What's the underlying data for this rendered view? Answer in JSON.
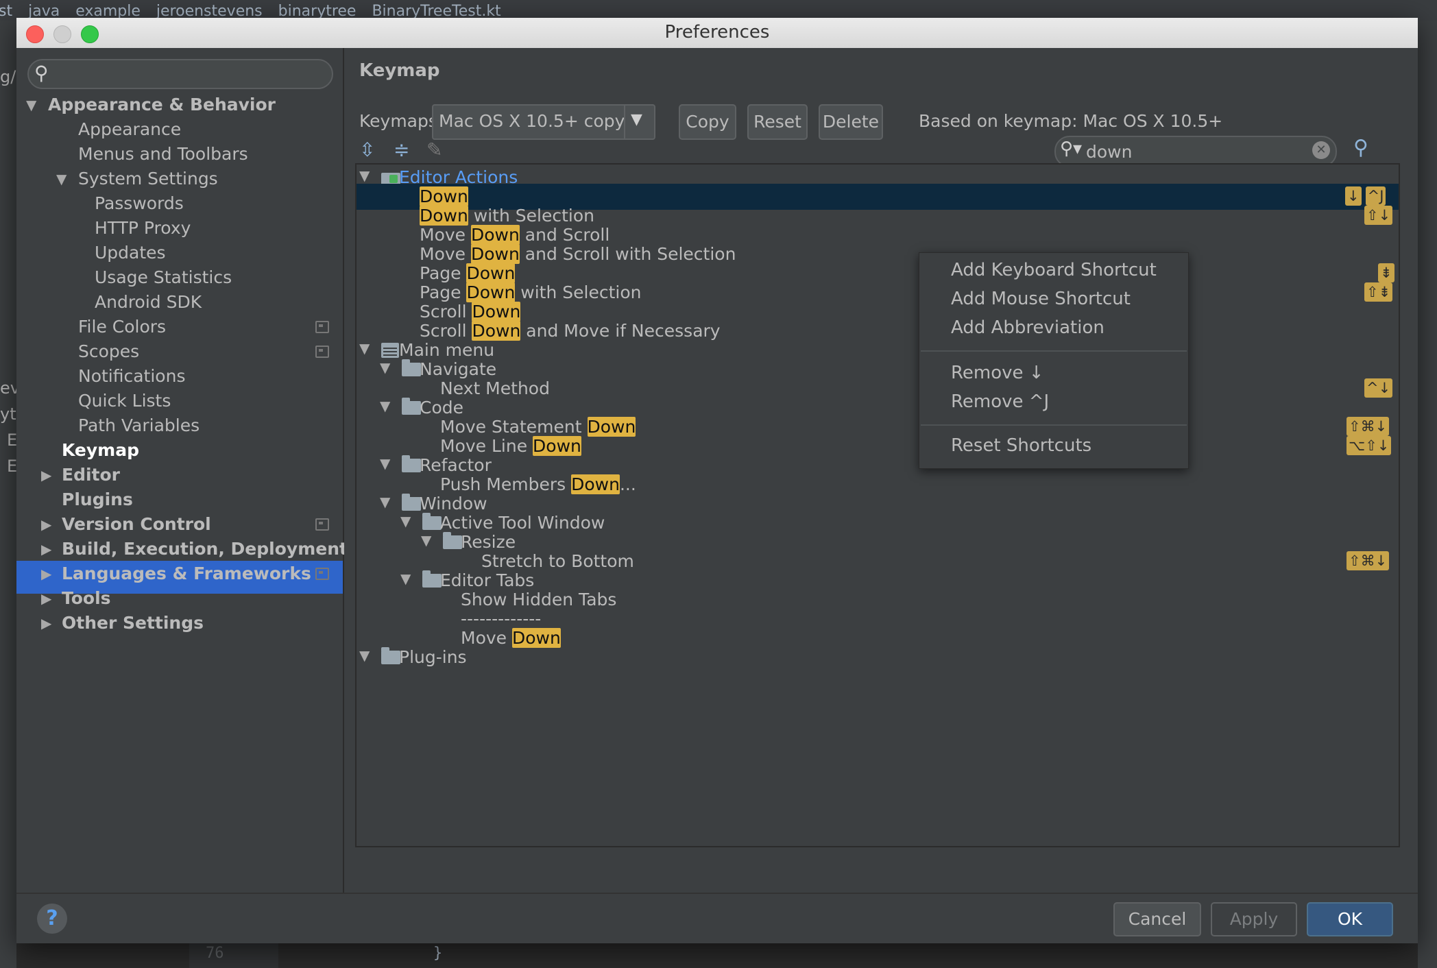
{
  "background": {
    "breadcrumbs": [
      "st",
      "java",
      "example",
      "jeroenstevens",
      "binarytree",
      "BinaryTreeTest.kt"
    ],
    "left_fragments": [
      "g/",
      "ev",
      "yt",
      "E",
      "E"
    ],
    "line_number": "76",
    "code_fragment": "}"
  },
  "window": {
    "title": "Preferences"
  },
  "sidebar": {
    "search_placeholder": "",
    "items": [
      {
        "label": "Appearance & Behavior"
      },
      {
        "label": "Appearance"
      },
      {
        "label": "Menus and Toolbars"
      },
      {
        "label": "System Settings"
      },
      {
        "label": "Passwords"
      },
      {
        "label": "HTTP Proxy"
      },
      {
        "label": "Updates"
      },
      {
        "label": "Usage Statistics"
      },
      {
        "label": "Android SDK"
      },
      {
        "label": "File Colors"
      },
      {
        "label": "Scopes"
      },
      {
        "label": "Notifications"
      },
      {
        "label": "Quick Lists"
      },
      {
        "label": "Path Variables"
      },
      {
        "label": "Keymap"
      },
      {
        "label": "Editor"
      },
      {
        "label": "Plugins"
      },
      {
        "label": "Version Control"
      },
      {
        "label": "Build, Execution, Deployment"
      },
      {
        "label": "Languages & Frameworks"
      },
      {
        "label": "Tools"
      },
      {
        "label": "Other Settings"
      }
    ]
  },
  "keymap": {
    "heading": "Keymap",
    "keymaps_label": "Keymaps:",
    "selected_keymap": "Mac OS X 10.5+ copy",
    "copy_label": "Copy",
    "reset_label": "Reset",
    "delete_label": "Delete",
    "based_on": "Based on keymap: Mac OS X 10.5+",
    "search_value": "down"
  },
  "tree": {
    "editor_actions": "Editor Actions",
    "down": "Down",
    "down_with_sel_rest": " with Selection",
    "move": "Move ",
    "and_scroll": " and Scroll",
    "and_scroll_sel": " and Scroll with Selection",
    "page": "Page ",
    "with_selection": " with Selection",
    "scroll": "Scroll ",
    "and_move_if": " and Move if Necessary",
    "main_menu": "Main menu",
    "navigate": "Navigate",
    "next_method": "Next Method",
    "code": "Code",
    "move_statement": "Move Statement ",
    "move_line": "Move Line ",
    "refactor": "Refactor",
    "push_members": "Push Members ",
    "ellipsis": "...",
    "window": "Window",
    "active_tool_window": "Active Tool Window",
    "resize": "Resize",
    "stretch_to_bottom": "Stretch to Bottom",
    "editor_tabs": "Editor Tabs",
    "show_hidden_tabs": "Show Hidden Tabs",
    "separator": "-------------",
    "plug_ins": "Plug-ins",
    "shortcuts": {
      "down": [
        "↓",
        "^J"
      ],
      "down_sel": [
        "⇧↓"
      ],
      "page_down": [
        "⇟"
      ],
      "page_down_sel": [
        "⇧⇟"
      ],
      "next_method": [
        "^↓"
      ],
      "move_statement": [
        "⇧⌘↓"
      ],
      "move_line": [
        "⌥⇧↓"
      ],
      "stretch": [
        "⇧⌘↓"
      ]
    }
  },
  "context_menu": {
    "add_keyboard": "Add Keyboard Shortcut",
    "add_mouse": "Add Mouse Shortcut",
    "add_abbrev": "Add Abbreviation",
    "remove_1": "Remove ↓",
    "remove_2": "Remove ^J",
    "reset": "Reset Shortcuts"
  },
  "footer": {
    "help": "?",
    "cancel": "Cancel",
    "apply": "Apply",
    "ok": "OK"
  }
}
